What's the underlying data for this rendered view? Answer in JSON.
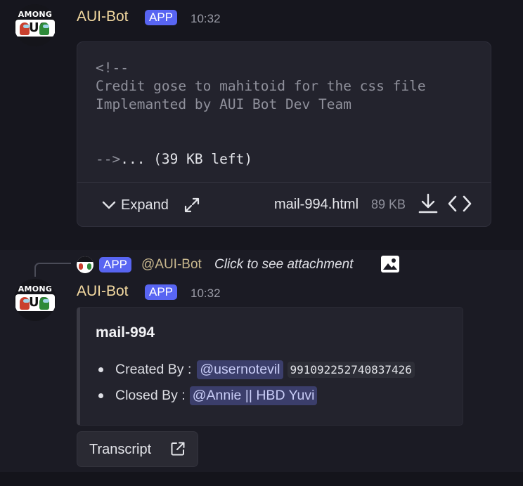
{
  "message1": {
    "avatar_text": "AMONG",
    "avatar_letters": "US",
    "username": "AUI-Bot",
    "badge": "APP",
    "timestamp": "10:32",
    "attachment": {
      "code_lines": [
        "<!--",
        "Credit gose to mahitoid for the css file",
        "Implemanted by AUI Bot Dev Team",
        "",
        ""
      ],
      "code_tail_close": "-->",
      "code_tail_more": "... (39 KB left)",
      "expand_label": "Expand",
      "filename": "mail-994.html",
      "filesize": "89 KB"
    }
  },
  "message2": {
    "reply": {
      "badge": "APP",
      "mention": "@AUI-Bot",
      "text": "Click to see attachment"
    },
    "avatar_text": "AMONG",
    "avatar_letters": "US",
    "username": "AUI-Bot",
    "badge": "APP",
    "timestamp": "10:32",
    "embed": {
      "title": "mail-994",
      "created_by_label": "Created By :",
      "created_by_mention": "@usernotevil",
      "created_by_id": "991092252740837426",
      "closed_by_label": "Closed By :",
      "closed_by_mention": "@Annie || HBD Yuvi"
    },
    "transcript_label": "Transcript"
  },
  "icons": {
    "expand": "chevron-down-icon",
    "fullscreen": "expand-arrows-icon",
    "download": "download-icon",
    "code": "code-brackets-icon",
    "image": "image-icon",
    "external": "external-link-icon"
  },
  "colors": {
    "username": "#f3d9a0",
    "app_badge": "#5865f2",
    "mention_bg": "#3b3e6b",
    "mention_text": "#c9cdf7"
  }
}
